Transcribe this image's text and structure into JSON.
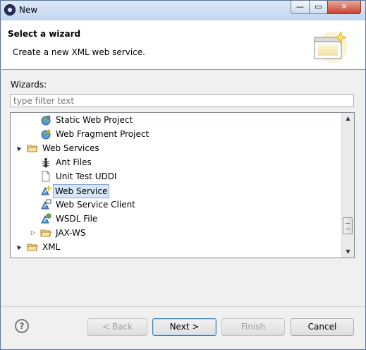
{
  "window": {
    "title": "New"
  },
  "titlebar": {
    "min_glyph": "—",
    "max_glyph": "▭",
    "close_glyph": "✕"
  },
  "header": {
    "title": "Select a wizard",
    "description": "Create a new XML web service."
  },
  "wizards_label": "Wizards:",
  "filter": {
    "placeholder": "type filter text",
    "value": ""
  },
  "tree": {
    "items": [
      {
        "label": "Static Web Project",
        "icon": "globe-icon",
        "twisty": ""
      },
      {
        "label": "Web Fragment Project",
        "icon": "globe-icon",
        "twisty": ""
      },
      {
        "label": "Web Services",
        "icon": "folder-open-icon",
        "twisty": "▲"
      },
      {
        "label": "Ant Files",
        "icon": "ant-icon",
        "twisty": ""
      },
      {
        "label": "Unit Test UDDI",
        "icon": "file-icon",
        "twisty": ""
      },
      {
        "label": "Web Service",
        "icon": "web-service-icon",
        "twisty": "",
        "selected": true
      },
      {
        "label": "Web Service Client",
        "icon": "web-service-client-icon",
        "twisty": ""
      },
      {
        "label": "WSDL File",
        "icon": "wsdl-file-icon",
        "twisty": ""
      },
      {
        "label": "JAX-WS",
        "icon": "folder-icon",
        "twisty": "▷"
      },
      {
        "label": "XML",
        "icon": "folder-open-icon",
        "twisty": "▲"
      }
    ],
    "scroll_up": "▲",
    "scroll_down": "▼"
  },
  "buttons": {
    "help": "?",
    "back": "< Back",
    "next": "Next >",
    "finish": "Finish",
    "cancel": "Cancel"
  }
}
